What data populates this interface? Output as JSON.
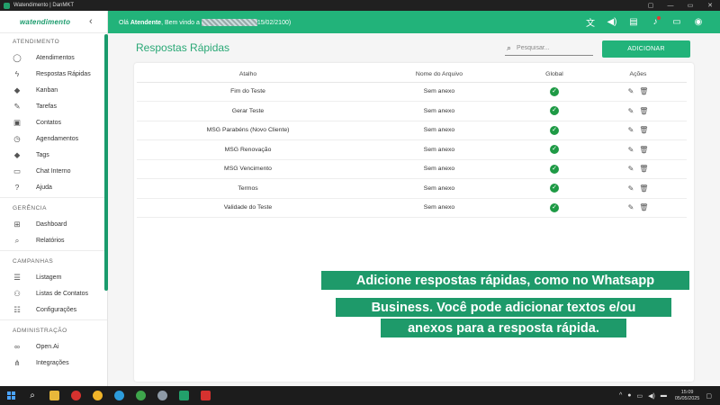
{
  "window": {
    "title": "Watendimento | DanMKT",
    "controls": [
      "▢",
      "—",
      "▭",
      "✕"
    ]
  },
  "brand": {
    "logo_text": "watendimento"
  },
  "header": {
    "greeting_prefix": "Olá ",
    "greeting_user": "Atendente",
    "greeting_middle": ", Bem vindo a ",
    "greeting_suffix": "15/02/2100)",
    "icons": [
      "translate-icon",
      "volume-icon",
      "chat-icon",
      "bell-icon",
      "messages-icon",
      "account-icon"
    ]
  },
  "sidebar": {
    "sections": [
      {
        "title": "ATENDIMENTO",
        "items": [
          {
            "label": "Atendimentos",
            "icon": "whatsapp-icon"
          },
          {
            "label": "Respostas Rápidas",
            "icon": "flash-icon"
          },
          {
            "label": "Kanban",
            "icon": "tag-icon"
          },
          {
            "label": "Tarefas",
            "icon": "pencil-icon"
          },
          {
            "label": "Contatos",
            "icon": "contact-card-icon"
          },
          {
            "label": "Agendamentos",
            "icon": "clock-icon"
          },
          {
            "label": "Tags",
            "icon": "tag-icon"
          },
          {
            "label": "Chat Interno",
            "icon": "chat-bubble-icon"
          },
          {
            "label": "Ajuda",
            "icon": "help-icon"
          }
        ]
      },
      {
        "title": "GERÊNCIA",
        "items": [
          {
            "label": "Dashboard",
            "icon": "dashboard-icon"
          },
          {
            "label": "Relatórios",
            "icon": "search-icon"
          }
        ]
      },
      {
        "title": "CAMPANHAS",
        "items": [
          {
            "label": "Listagem",
            "icon": "list-icon"
          },
          {
            "label": "Listas de Contatos",
            "icon": "people-icon"
          },
          {
            "label": "Configurações",
            "icon": "settings-list-icon"
          }
        ]
      },
      {
        "title": "ADMINISTRAÇÃO",
        "items": [
          {
            "label": "Open.Ai",
            "icon": "infinity-icon"
          },
          {
            "label": "Integrações",
            "icon": "integrations-icon"
          }
        ]
      }
    ]
  },
  "main": {
    "title": "Respostas Rápidas",
    "search_placeholder": "Pesquisar...",
    "add_button": "ADICIONAR",
    "columns": [
      "Atalho",
      "Nome do Arquivo",
      "Global",
      "Ações"
    ],
    "rows": [
      {
        "atalho": "Fim do Teste",
        "arquivo": "Sem anexo",
        "global": true
      },
      {
        "atalho": "Gerar Teste",
        "arquivo": "Sem anexo",
        "global": true
      },
      {
        "atalho": "MSG Parabéns (Novo Cliente)",
        "arquivo": "Sem anexo",
        "global": true
      },
      {
        "atalho": "MSG Renovação",
        "arquivo": "Sem anexo",
        "global": true
      },
      {
        "atalho": "MSG Vencimento",
        "arquivo": "Sem anexo",
        "global": true
      },
      {
        "atalho": "Termos",
        "arquivo": "Sem anexo",
        "global": true
      },
      {
        "atalho": "Validade do Teste",
        "arquivo": "Sem anexo",
        "global": true
      }
    ]
  },
  "caption": {
    "line1": "Adicione respostas rápidas, como no Whatsapp",
    "line2": "Business. Você pode adicionar textos e/ou",
    "line3": "anexos para a resposta rápida."
  },
  "taskbar": {
    "time": "15:09",
    "date": "05/05/2025"
  },
  "colors": {
    "accent": "#22b37a",
    "brand_green": "#1a9b6c",
    "caption_bg": "#1e9a6a",
    "check_green": "#1e9a45"
  }
}
